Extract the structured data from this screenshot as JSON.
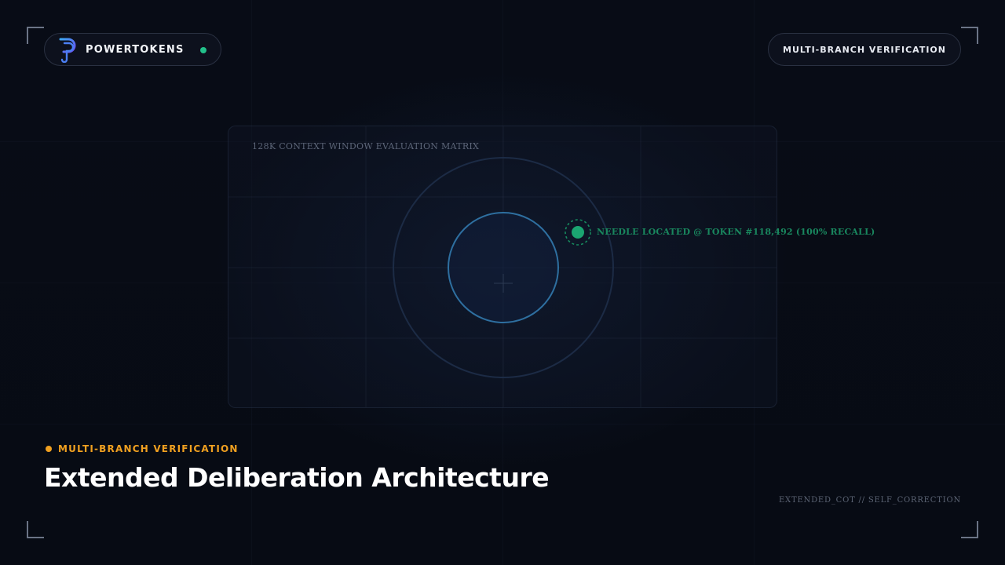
{
  "brand": {
    "name": "POWERTOKENS",
    "status_color": "#22c08a"
  },
  "mode_badge": {
    "label": "MULTI-BRANCH VERIFICATION"
  },
  "matrix": {
    "title": "128K CONTEXT WINDOW EVALUATION MATRIX",
    "needle_label": "NEEDLE LOCATED @ TOKEN #118,492 (100% RECALL)",
    "needle_color": "#19875e"
  },
  "slide": {
    "kicker": "MULTI-BRANCH VERIFICATION",
    "kicker_color": "#f0a020",
    "headline": "Extended Deliberation Architecture",
    "footer_code": "EXTENDED_COT // SELF_CORRECTION"
  },
  "icons": {
    "logo": "powertokens-p-logo",
    "crosshair": "crosshair-icon"
  }
}
